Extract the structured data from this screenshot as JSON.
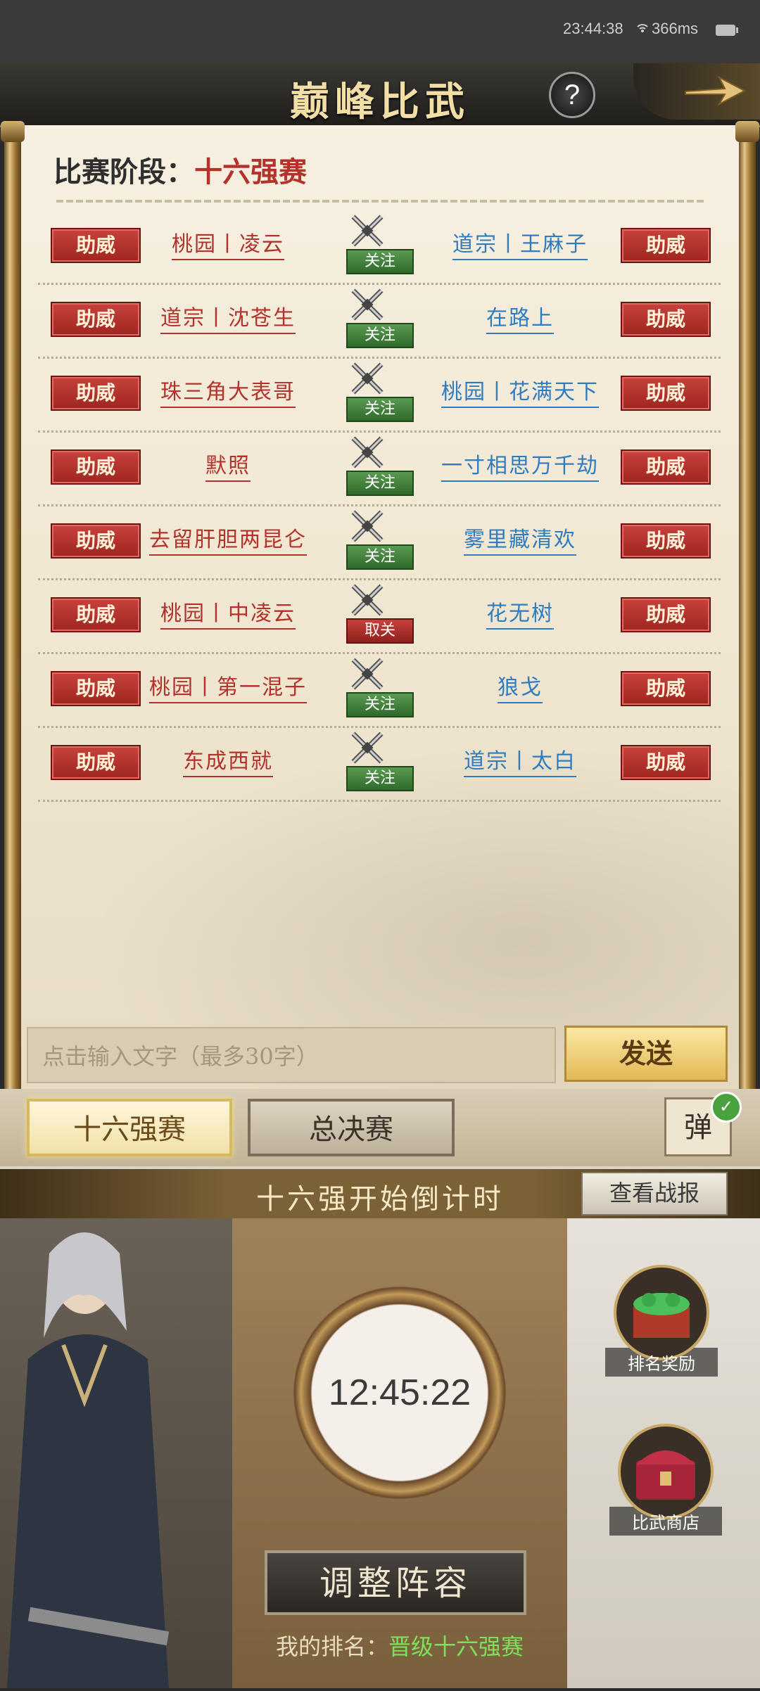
{
  "status_bar": {
    "time": "23:44:38",
    "ping": "366ms"
  },
  "header": {
    "title": "巅峰比武",
    "help": "?"
  },
  "stage": {
    "label": "比赛阶段：",
    "value": "十六强赛"
  },
  "cheer_label": "助威",
  "matches": [
    {
      "left": "桃园丨凌云",
      "right": "道宗丨王麻子",
      "follow": "关注"
    },
    {
      "left": "道宗丨沈苍生",
      "right": "在路上",
      "follow": "关注"
    },
    {
      "left": "珠三角大表哥",
      "right": "桃园丨花满天下",
      "follow": "关注"
    },
    {
      "left": "默照",
      "right": "一寸相思万千劫",
      "follow": "关注"
    },
    {
      "left": "去留肝胆两昆仑",
      "right": "雾里藏清欢",
      "follow": "关注"
    },
    {
      "left": "桃园丨中凌云",
      "right": "花无树",
      "follow": "取关"
    },
    {
      "left": "桃园丨第一混子",
      "right": "狼戈",
      "follow": "关注"
    },
    {
      "left": "东成西就",
      "right": "道宗丨太白",
      "follow": "关注"
    }
  ],
  "chat": {
    "placeholder": "点击输入文字（最多30字）",
    "send": "发送"
  },
  "tabs": {
    "round16": "十六强赛",
    "final": "总决赛",
    "danmu": "弹"
  },
  "countdown": {
    "title": "十六强开始倒计时",
    "time": "12:45:22",
    "report": "查看战报"
  },
  "actions": {
    "lineup": "调整阵容",
    "rank_rewards": "排名奖励",
    "shop": "比武商店"
  },
  "my_rank": {
    "label": "我的排名：",
    "value": "晋级十六强赛"
  },
  "icons": [
    "wifi-icon",
    "battery-icon",
    "help-icon",
    "back-arrow-icon",
    "crossed-swords-icon",
    "check-icon",
    "rank-rewards-icon",
    "shop-chest-icon"
  ]
}
